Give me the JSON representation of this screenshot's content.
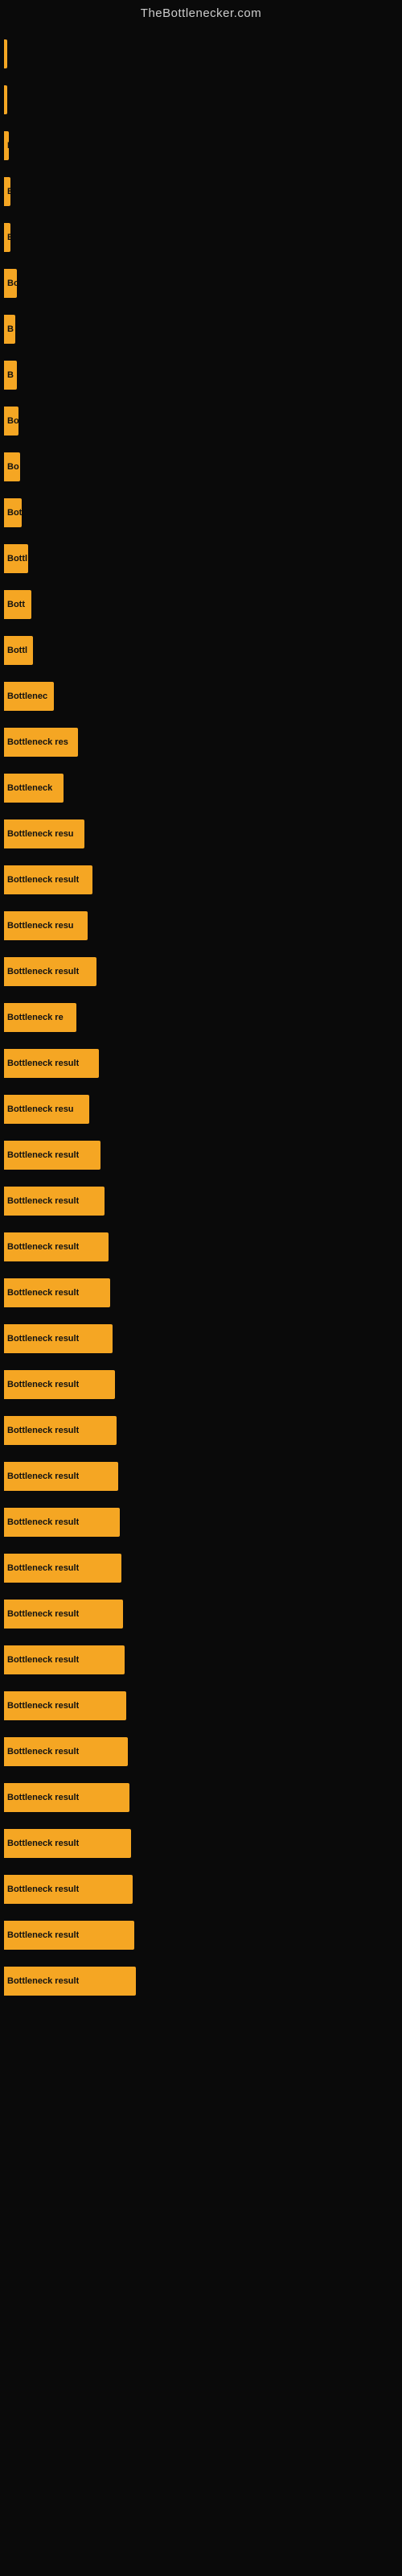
{
  "site": {
    "title": "TheBottlenecker.com"
  },
  "bars": [
    {
      "label": "|",
      "width": 4
    },
    {
      "label": "",
      "width": 4
    },
    {
      "label": "E",
      "width": 6
    },
    {
      "label": "B",
      "width": 8
    },
    {
      "label": "E",
      "width": 8
    },
    {
      "label": "Bo",
      "width": 16
    },
    {
      "label": "B",
      "width": 14
    },
    {
      "label": "B",
      "width": 16
    },
    {
      "label": "Bo",
      "width": 18
    },
    {
      "label": "Bo",
      "width": 20
    },
    {
      "label": "Bot",
      "width": 22
    },
    {
      "label": "Bottl",
      "width": 30
    },
    {
      "label": "Bott",
      "width": 34
    },
    {
      "label": "Bottl",
      "width": 36
    },
    {
      "label": "Bottlenec",
      "width": 62
    },
    {
      "label": "Bottleneck res",
      "width": 92
    },
    {
      "label": "Bottleneck",
      "width": 74
    },
    {
      "label": "Bottleneck resu",
      "width": 100
    },
    {
      "label": "Bottleneck result",
      "width": 110
    },
    {
      "label": "Bottleneck resu",
      "width": 104
    },
    {
      "label": "Bottleneck result",
      "width": 115
    },
    {
      "label": "Bottleneck re",
      "width": 90
    },
    {
      "label": "Bottleneck result",
      "width": 118
    },
    {
      "label": "Bottleneck resu",
      "width": 106
    },
    {
      "label": "Bottleneck result",
      "width": 120
    },
    {
      "label": "Bottleneck result",
      "width": 125
    },
    {
      "label": "Bottleneck result",
      "width": 130
    },
    {
      "label": "Bottleneck result",
      "width": 132
    },
    {
      "label": "Bottleneck result",
      "width": 135
    },
    {
      "label": "Bottleneck result",
      "width": 138
    },
    {
      "label": "Bottleneck result",
      "width": 140
    },
    {
      "label": "Bottleneck result",
      "width": 142
    },
    {
      "label": "Bottleneck result",
      "width": 144
    },
    {
      "label": "Bottleneck result",
      "width": 146
    },
    {
      "label": "Bottleneck result",
      "width": 148
    },
    {
      "label": "Bottleneck result",
      "width": 150
    },
    {
      "label": "Bottleneck result",
      "width": 152
    },
    {
      "label": "Bottleneck result",
      "width": 154
    },
    {
      "label": "Bottleneck result",
      "width": 156
    },
    {
      "label": "Bottleneck result",
      "width": 158
    },
    {
      "label": "Bottleneck result",
      "width": 160
    },
    {
      "label": "Bottleneck result",
      "width": 162
    },
    {
      "label": "Bottleneck result",
      "width": 164
    }
  ]
}
